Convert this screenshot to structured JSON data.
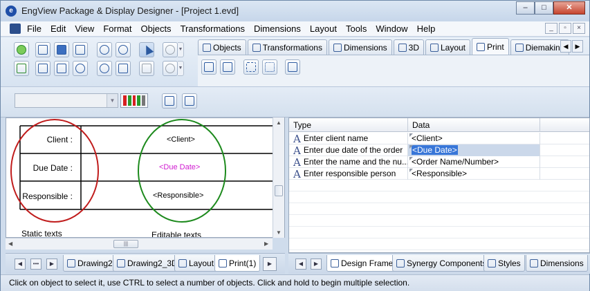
{
  "window": {
    "title": "EngView Package & Display Designer - [Project 1.evd]",
    "buttons": {
      "minimize": "‒",
      "maximize": "□",
      "close": "✕"
    }
  },
  "menu": {
    "items": [
      "File",
      "Edit",
      "View",
      "Format",
      "Objects",
      "Transformations",
      "Dimensions",
      "Layout",
      "Tools",
      "Window",
      "Help"
    ],
    "mdi_buttons": [
      "_",
      "▫",
      "×"
    ]
  },
  "top_tabs": [
    {
      "label": "Objects",
      "icon": "objects-icon"
    },
    {
      "label": "Transformations",
      "icon": "transformations-icon"
    },
    {
      "label": "Dimensions",
      "icon": "dimensions-icon"
    },
    {
      "label": "3D",
      "icon": "cube-icon"
    },
    {
      "label": "Layout",
      "icon": "layout-icon"
    },
    {
      "label": "Print",
      "icon": "print-icon",
      "active": true
    },
    {
      "label": "Diemaking",
      "icon": "diemaking-icon"
    }
  ],
  "drawing": {
    "static_labels": [
      "Client :",
      "Due Date :",
      "Responsible :"
    ],
    "editable_values": [
      "<Client>",
      "<Due Date>",
      "<Responsible>"
    ],
    "caption_static": "Static texts",
    "caption_editable": "Editable texts",
    "colors": {
      "static_circle": "#c01c1c",
      "editable_circle": "#1d8a1d",
      "due_date_text": "#d01ad0"
    }
  },
  "grid": {
    "columns": [
      "Type",
      "Data"
    ],
    "rows": [
      {
        "type": "Enter client name",
        "data": "<Client>"
      },
      {
        "type": "Enter due date of the order",
        "data": "<Due Date>",
        "selected": true
      },
      {
        "type": "Enter the name and the nu...",
        "data": "<Order Name/Number>"
      },
      {
        "type": "Enter responsible person",
        "data": "<Responsible>"
      }
    ],
    "type_icon": "A"
  },
  "bottom_tabs_left": [
    {
      "label": "Drawing2",
      "icon": "drawing-icon"
    },
    {
      "label": "Drawing2_3D",
      "icon": "cube-icon"
    },
    {
      "label": "Layout",
      "icon": "layout-icon"
    },
    {
      "label": "Print(1)",
      "icon": "print-icon",
      "active": true
    }
  ],
  "bottom_tabs_right": [
    {
      "label": "Design Frame",
      "icon": "design-frame-icon",
      "active": true
    },
    {
      "label": "Synergy Components",
      "icon": "synergy-icon"
    },
    {
      "label": "Styles",
      "icon": "styles-icon"
    },
    {
      "label": "Dimensions",
      "icon": "dimensions-icon"
    }
  ],
  "status": "Click on object to select it, use CTRL to select a number of objects. Click and hold to begin multiple selection."
}
